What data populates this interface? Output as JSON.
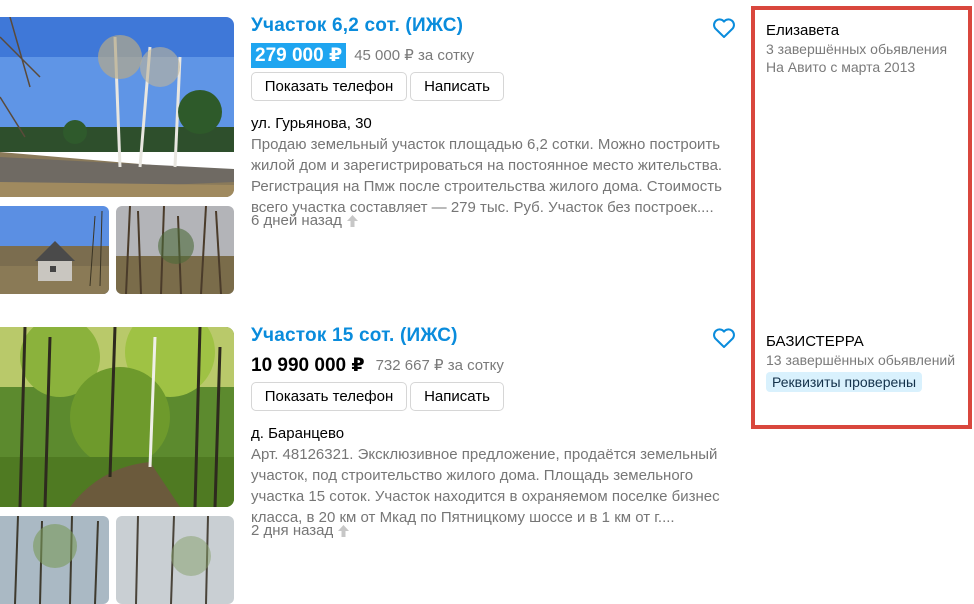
{
  "listings": [
    {
      "title": "Участок 6,2 сот. (ИЖС)",
      "price": "279 000 ₽",
      "price_per": "45 000 ₽ за сотку",
      "phone_button": "Показать телефон",
      "write_button": "Написать",
      "address": "ул. Гурьянова, 30",
      "description": "Продаю земельный участок площадью 6,2 сотки. Можно построить жилой дом и зарегистрироваться на постоянное место жительства. Регистрация на Пмж после строительства жилого дома. Стоимость всего участка составляет — 279 тыс. Руб. Участок без построек....",
      "date": "6 дней назад",
      "icons": [
        "heart-icon",
        "raise-arrow-icon"
      ]
    },
    {
      "title": "Участок 15 сот. (ИЖС)",
      "price": "10 990 000 ₽",
      "price_per": "732 667 ₽ за сотку",
      "phone_button": "Показать телефон",
      "write_button": "Написать",
      "address": "д. Баранцево",
      "description": "Арт. 48126321. Эксклюзивное предложение, продаётся земельный участок, под строительство жилого дома. Площадь земельного участка 15 соток. Участок находится в охраняемом поселке бизнес класса, в 20 км от Мкад по Пятницкому шоссе и в 1 км от г....",
      "date": "2 дня назад",
      "icons": [
        "heart-icon",
        "raise-arrow-icon"
      ]
    }
  ],
  "sellers": [
    {
      "name": "Елизавета",
      "ads": "3 завершённых обьявления",
      "since": "На Авито с марта 2013"
    },
    {
      "name": "БАЗИСТЕРРА",
      "ads": "13 завершённых обьявлений",
      "badge": "Реквизиты проверены"
    }
  ],
  "colors": {
    "title": "#0a8cdc",
    "price_highlight": "#1fa5f0",
    "panel_border": "#d9473d",
    "badge_bg": "#d9f1fd"
  }
}
